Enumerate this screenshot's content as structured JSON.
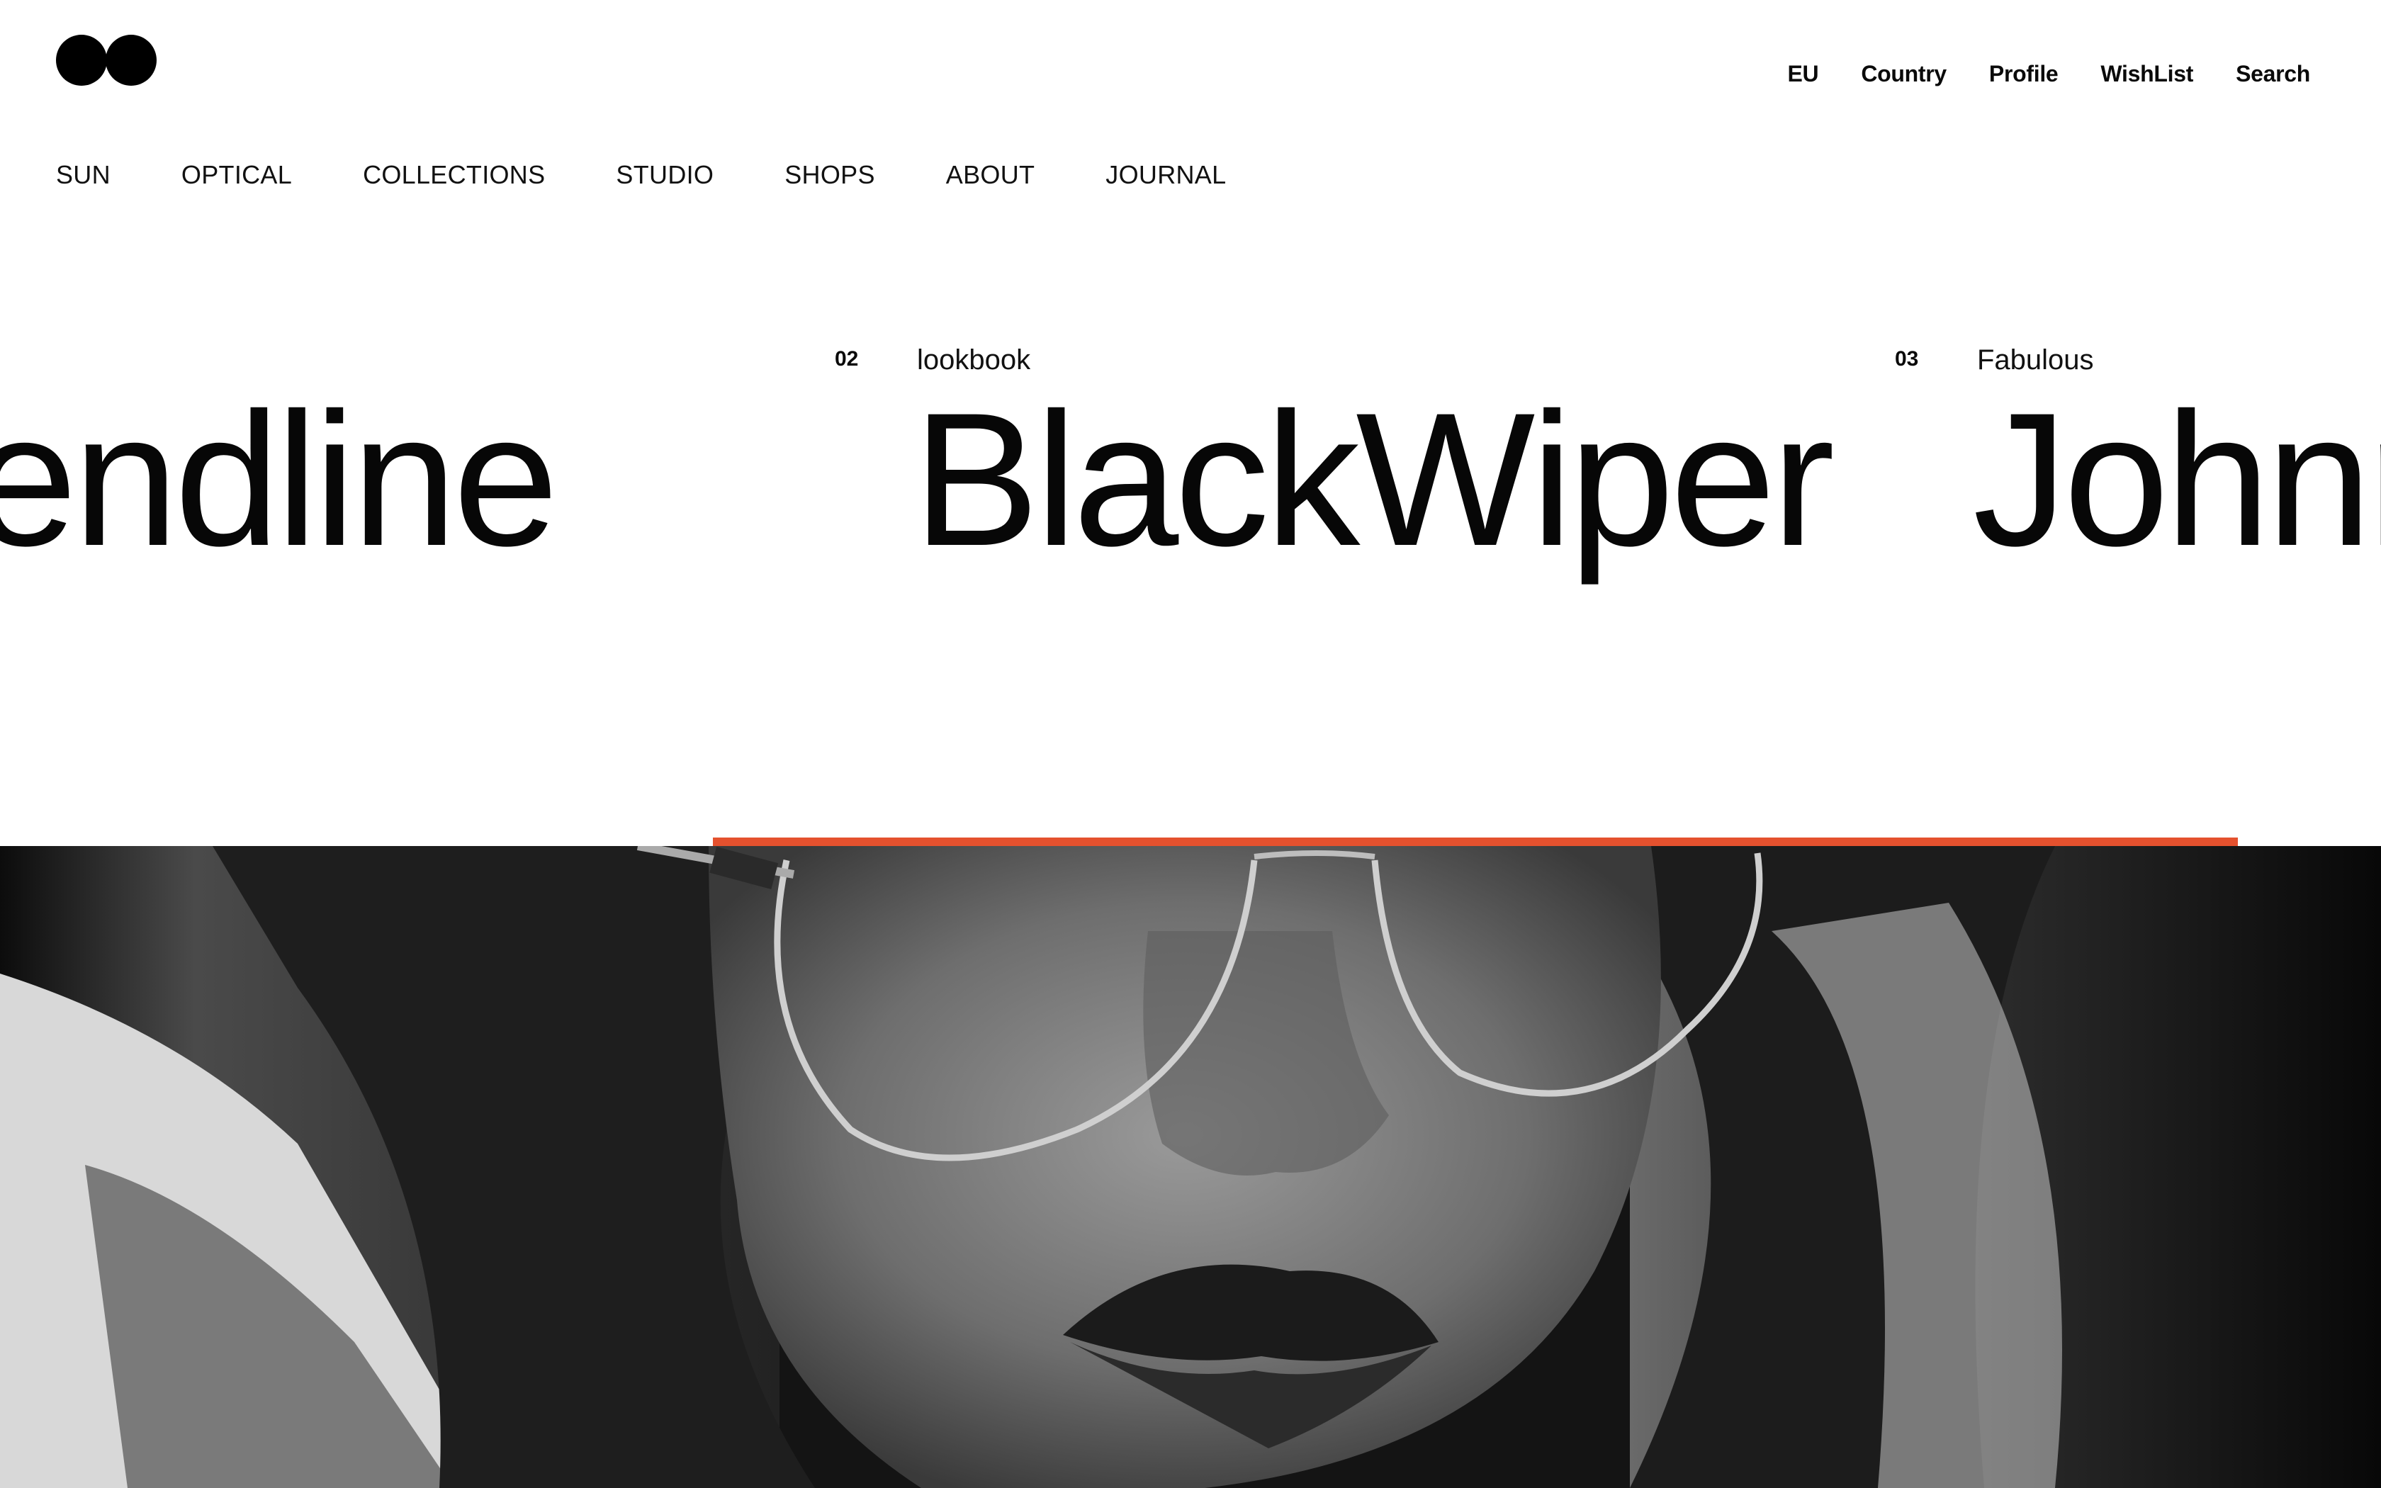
{
  "brand": {
    "logo_icon": "two-dots-logo"
  },
  "utility_nav": [
    {
      "label": "EU"
    },
    {
      "label": "Country"
    },
    {
      "label": "Profile"
    },
    {
      "label": "WishList"
    },
    {
      "label": "Search"
    }
  ],
  "main_nav": [
    {
      "label": "SUN"
    },
    {
      "label": "OPTICAL"
    },
    {
      "label": "COLLECTIONS"
    },
    {
      "label": "STUDIO"
    },
    {
      "label": "SHOPS"
    },
    {
      "label": "ABOUT"
    },
    {
      "label": "JOURNAL"
    }
  ],
  "slides": [
    {
      "title": "endline"
    },
    {
      "number": "02",
      "kicker": "lookbook",
      "title": "BlackWiper"
    },
    {
      "number": "03",
      "kicker": "Fabulous",
      "title": "Johnn"
    }
  ],
  "colors": {
    "accent": "#e4512e",
    "text": "#0a0a0a",
    "background": "#ffffff"
  },
  "hero": {
    "image": "black-and-white portrait photo"
  }
}
